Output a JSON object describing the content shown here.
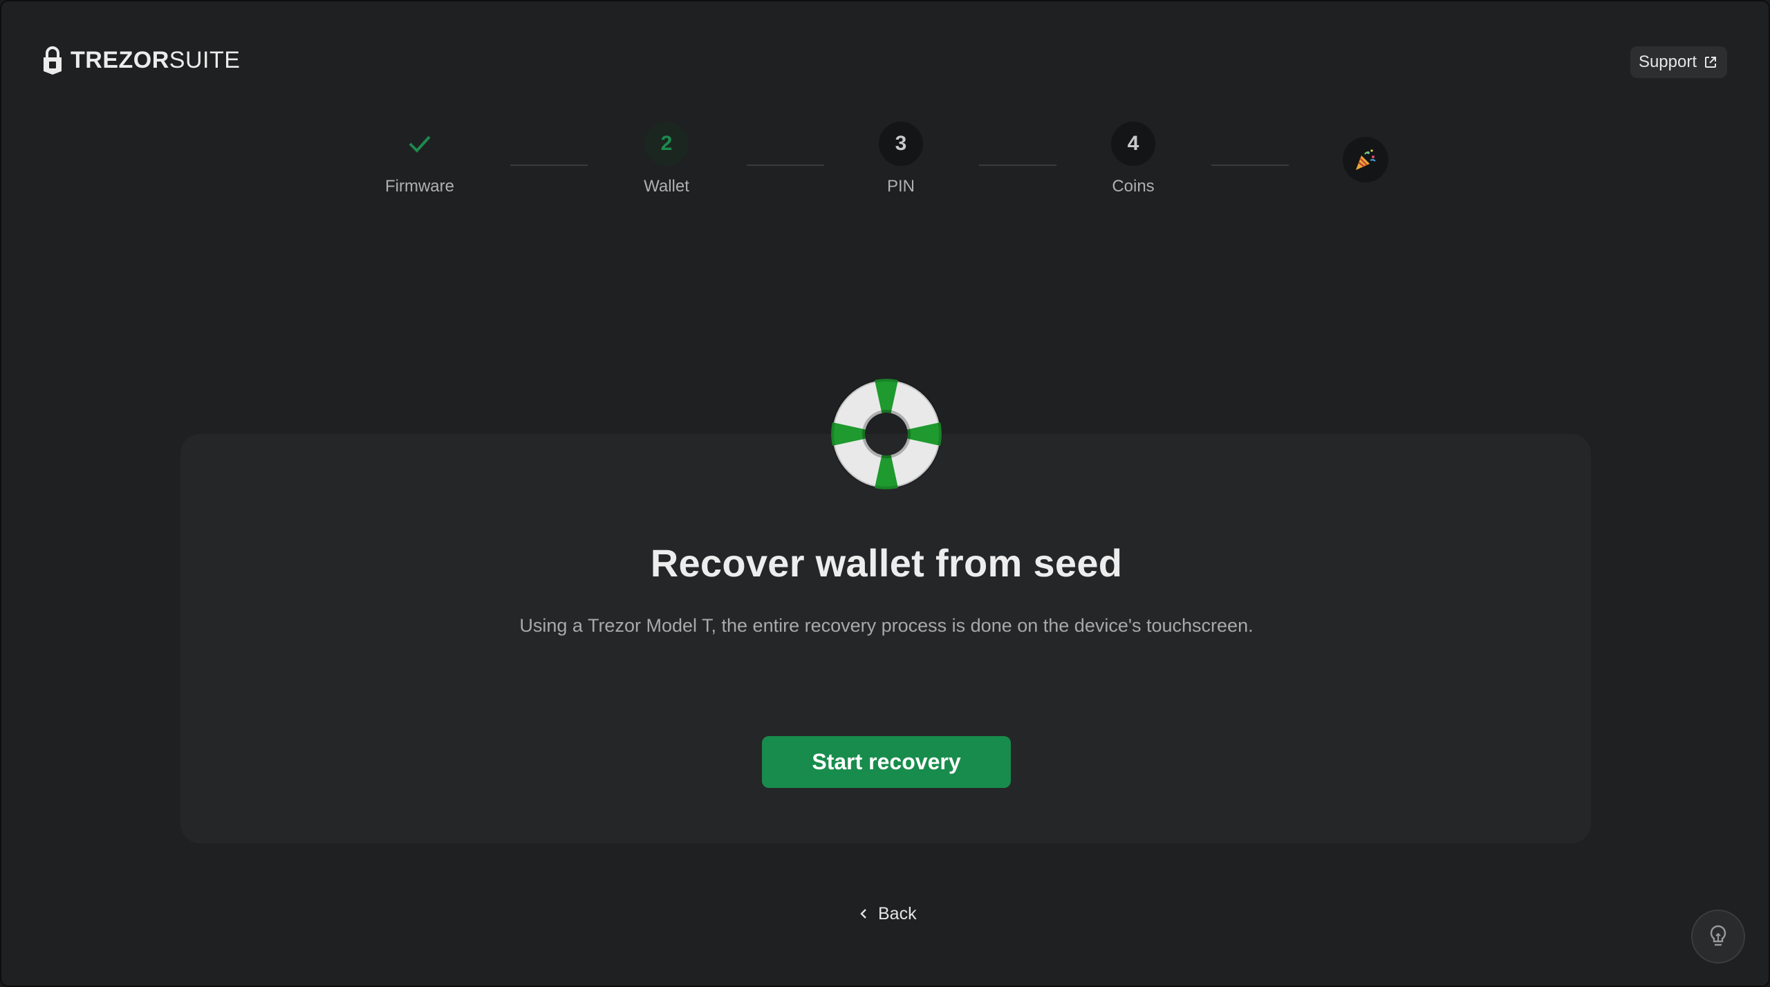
{
  "header": {
    "brand_strong": "TREZOR",
    "brand_light": "SUITE",
    "support_label": "Support"
  },
  "stepper": {
    "steps": [
      {
        "label": "Firmware",
        "number": "",
        "state": "done"
      },
      {
        "label": "Wallet",
        "number": "2",
        "state": "active"
      },
      {
        "label": "PIN",
        "number": "3",
        "state": "pending"
      },
      {
        "label": "Coins",
        "number": "4",
        "state": "pending"
      }
    ],
    "final_icon": "party-popper-icon"
  },
  "main": {
    "illustration": "lifebuoy-icon",
    "title": "Recover wallet from seed",
    "description": "Using a Trezor Model T, the entire recovery process is done on the device's touchscreen.",
    "primary_button": "Start recovery",
    "back_label": "Back"
  },
  "footer": {
    "tip_icon": "lightbulb-icon"
  },
  "colors": {
    "accent": "#188c4c",
    "background": "#1f2021",
    "card": "#252628"
  }
}
